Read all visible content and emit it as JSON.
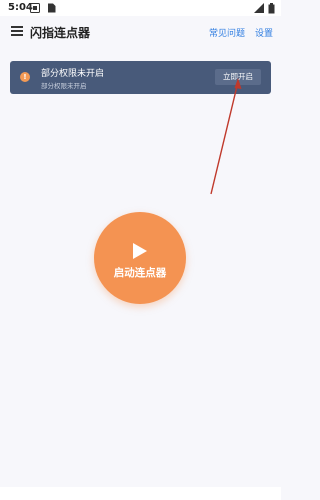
{
  "status_bar": {
    "time": "5:04"
  },
  "app_bar": {
    "title": "闪指连点器",
    "faq_link": "常见问题",
    "settings_link": "设置"
  },
  "permission_banner": {
    "icon_symbol": "!",
    "title": "部分权限未开启",
    "subtitle": "部分权限未开启",
    "action_label": "立即开启"
  },
  "start_button": {
    "label": "启动连点器",
    "icon": "play-icon"
  },
  "colors": {
    "accent_orange": "#f49352",
    "banner_bg": "#485a7a",
    "link_blue": "#2f7de1",
    "annotation_arrow": "#c0392b"
  }
}
